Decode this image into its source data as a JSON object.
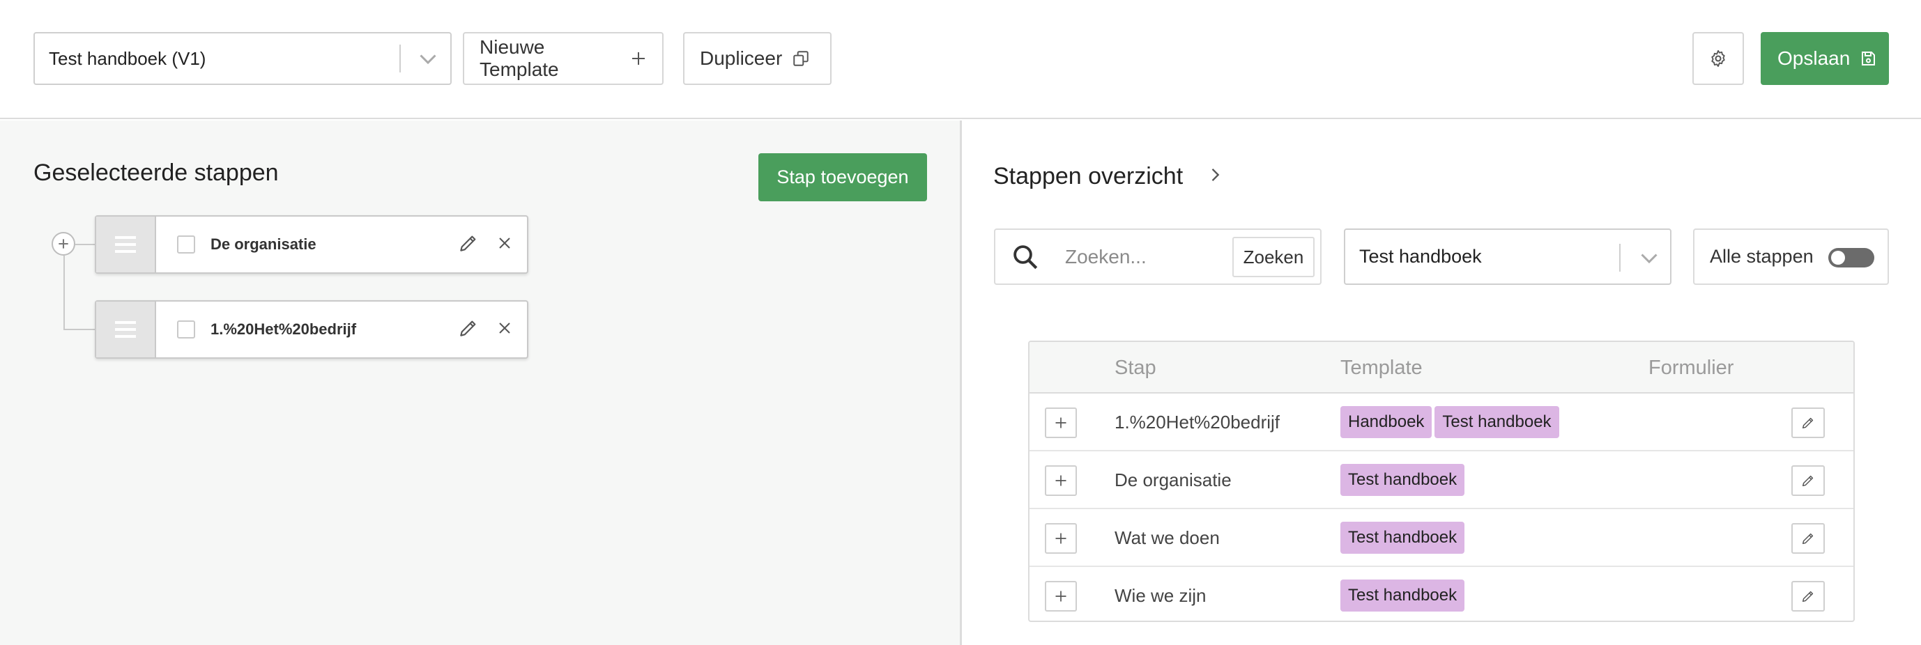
{
  "topbar": {
    "template_select": {
      "value": "Test handboek (V1)"
    },
    "new_template_label": "Nieuwe Template",
    "duplicate_label": "Dupliceer",
    "save_label": "Opslaan",
    "settings_icon": "gear-icon"
  },
  "left": {
    "title": "Geselecteerde stappen",
    "add_step_label": "Stap toevoegen",
    "steps": [
      {
        "name": "De organisatie",
        "checked": false
      },
      {
        "name": "1.%20Het%20bedrijf",
        "checked": false
      }
    ]
  },
  "right": {
    "title": "Stappen overzicht",
    "search": {
      "placeholder": "Zoeken...",
      "value": "",
      "button_label": "Zoeken"
    },
    "filter_select": {
      "value": "Test handboek"
    },
    "toggle": {
      "label": "Alle stappen",
      "on": false
    },
    "table": {
      "headers": {
        "stap": "Stap",
        "template": "Template",
        "formulier": "Formulier"
      },
      "rows": [
        {
          "stap": "1.%20Het%20bedrijf",
          "tags": [
            "Handboek",
            "Test handboek"
          ]
        },
        {
          "stap": "De organisatie",
          "tags": [
            "Test handboek"
          ]
        },
        {
          "stap": "Wat we doen",
          "tags": [
            "Test handboek"
          ]
        },
        {
          "stap": "Wie we zijn",
          "tags": [
            "Test handboek"
          ]
        }
      ]
    }
  },
  "colors": {
    "primary_green": "#4a9e5c",
    "tag_purple": "#dcb6e4",
    "border": "#dcdcdc",
    "panel_bg": "#f6f7f6"
  }
}
